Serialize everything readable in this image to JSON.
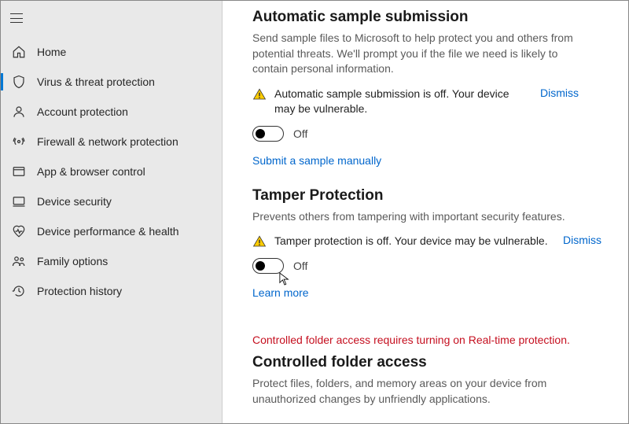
{
  "sidebar": {
    "items": [
      {
        "label": "Home",
        "icon": "home-icon"
      },
      {
        "label": "Virus & threat protection",
        "icon": "shield-icon",
        "active": true
      },
      {
        "label": "Account protection",
        "icon": "person-icon"
      },
      {
        "label": "Firewall & network protection",
        "icon": "network-icon"
      },
      {
        "label": "App & browser control",
        "icon": "app-icon"
      },
      {
        "label": "Device security",
        "icon": "device-icon"
      },
      {
        "label": "Device performance & health",
        "icon": "heart-icon"
      },
      {
        "label": "Family options",
        "icon": "family-icon"
      },
      {
        "label": "Protection history",
        "icon": "history-icon"
      }
    ]
  },
  "sections": {
    "sample": {
      "title": "Automatic sample submission",
      "desc": "Send sample files to Microsoft to help protect you and others from potential threats. We'll prompt you if the file we need is likely to contain personal information.",
      "warning": "Automatic sample submission is off. Your device may be vulnerable.",
      "dismiss": "Dismiss",
      "toggle_state": "Off",
      "link": "Submit a sample manually"
    },
    "tamper": {
      "title": "Tamper Protection",
      "desc": "Prevents others from tampering with important security features.",
      "warning": "Tamper protection is off. Your device may be vulnerable.",
      "dismiss": "Dismiss",
      "toggle_state": "Off",
      "link": "Learn more"
    },
    "cfa": {
      "error": "Controlled folder access requires turning on Real-time protection.",
      "title": "Controlled folder access",
      "desc": "Protect files, folders, and memory areas on your device from unauthorized changes by unfriendly applications."
    }
  }
}
